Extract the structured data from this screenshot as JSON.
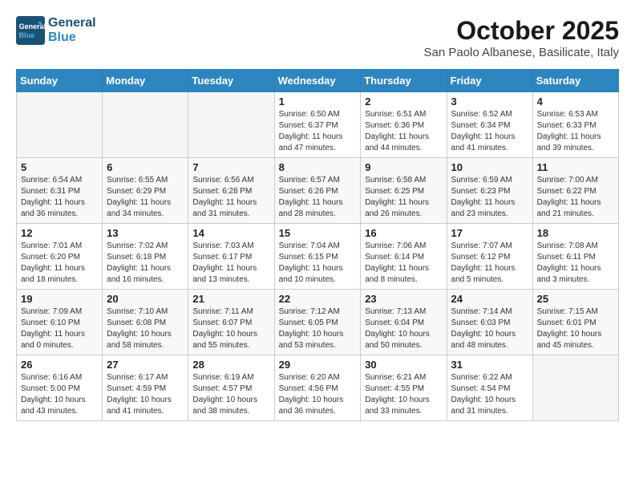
{
  "header": {
    "logo_line1": "General",
    "logo_line2": "Blue",
    "month_title": "October 2025",
    "location": "San Paolo Albanese, Basilicate, Italy"
  },
  "days_of_week": [
    "Sunday",
    "Monday",
    "Tuesday",
    "Wednesday",
    "Thursday",
    "Friday",
    "Saturday"
  ],
  "weeks": [
    [
      {
        "day": "",
        "info": ""
      },
      {
        "day": "",
        "info": ""
      },
      {
        "day": "",
        "info": ""
      },
      {
        "day": "1",
        "info": "Sunrise: 6:50 AM\nSunset: 6:37 PM\nDaylight: 11 hours\nand 47 minutes."
      },
      {
        "day": "2",
        "info": "Sunrise: 6:51 AM\nSunset: 6:36 PM\nDaylight: 11 hours\nand 44 minutes."
      },
      {
        "day": "3",
        "info": "Sunrise: 6:52 AM\nSunset: 6:34 PM\nDaylight: 11 hours\nand 41 minutes."
      },
      {
        "day": "4",
        "info": "Sunrise: 6:53 AM\nSunset: 6:33 PM\nDaylight: 11 hours\nand 39 minutes."
      }
    ],
    [
      {
        "day": "5",
        "info": "Sunrise: 6:54 AM\nSunset: 6:31 PM\nDaylight: 11 hours\nand 36 minutes."
      },
      {
        "day": "6",
        "info": "Sunrise: 6:55 AM\nSunset: 6:29 PM\nDaylight: 11 hours\nand 34 minutes."
      },
      {
        "day": "7",
        "info": "Sunrise: 6:56 AM\nSunset: 6:28 PM\nDaylight: 11 hours\nand 31 minutes."
      },
      {
        "day": "8",
        "info": "Sunrise: 6:57 AM\nSunset: 6:26 PM\nDaylight: 11 hours\nand 28 minutes."
      },
      {
        "day": "9",
        "info": "Sunrise: 6:58 AM\nSunset: 6:25 PM\nDaylight: 11 hours\nand 26 minutes."
      },
      {
        "day": "10",
        "info": "Sunrise: 6:59 AM\nSunset: 6:23 PM\nDaylight: 11 hours\nand 23 minutes."
      },
      {
        "day": "11",
        "info": "Sunrise: 7:00 AM\nSunset: 6:22 PM\nDaylight: 11 hours\nand 21 minutes."
      }
    ],
    [
      {
        "day": "12",
        "info": "Sunrise: 7:01 AM\nSunset: 6:20 PM\nDaylight: 11 hours\nand 18 minutes."
      },
      {
        "day": "13",
        "info": "Sunrise: 7:02 AM\nSunset: 6:18 PM\nDaylight: 11 hours\nand 16 minutes."
      },
      {
        "day": "14",
        "info": "Sunrise: 7:03 AM\nSunset: 6:17 PM\nDaylight: 11 hours\nand 13 minutes."
      },
      {
        "day": "15",
        "info": "Sunrise: 7:04 AM\nSunset: 6:15 PM\nDaylight: 11 hours\nand 10 minutes."
      },
      {
        "day": "16",
        "info": "Sunrise: 7:06 AM\nSunset: 6:14 PM\nDaylight: 11 hours\nand 8 minutes."
      },
      {
        "day": "17",
        "info": "Sunrise: 7:07 AM\nSunset: 6:12 PM\nDaylight: 11 hours\nand 5 minutes."
      },
      {
        "day": "18",
        "info": "Sunrise: 7:08 AM\nSunset: 6:11 PM\nDaylight: 11 hours\nand 3 minutes."
      }
    ],
    [
      {
        "day": "19",
        "info": "Sunrise: 7:09 AM\nSunset: 6:10 PM\nDaylight: 11 hours\nand 0 minutes."
      },
      {
        "day": "20",
        "info": "Sunrise: 7:10 AM\nSunset: 6:08 PM\nDaylight: 10 hours\nand 58 minutes."
      },
      {
        "day": "21",
        "info": "Sunrise: 7:11 AM\nSunset: 6:07 PM\nDaylight: 10 hours\nand 55 minutes."
      },
      {
        "day": "22",
        "info": "Sunrise: 7:12 AM\nSunset: 6:05 PM\nDaylight: 10 hours\nand 53 minutes."
      },
      {
        "day": "23",
        "info": "Sunrise: 7:13 AM\nSunset: 6:04 PM\nDaylight: 10 hours\nand 50 minutes."
      },
      {
        "day": "24",
        "info": "Sunrise: 7:14 AM\nSunset: 6:03 PM\nDaylight: 10 hours\nand 48 minutes."
      },
      {
        "day": "25",
        "info": "Sunrise: 7:15 AM\nSunset: 6:01 PM\nDaylight: 10 hours\nand 45 minutes."
      }
    ],
    [
      {
        "day": "26",
        "info": "Sunrise: 6:16 AM\nSunset: 5:00 PM\nDaylight: 10 hours\nand 43 minutes."
      },
      {
        "day": "27",
        "info": "Sunrise: 6:17 AM\nSunset: 4:59 PM\nDaylight: 10 hours\nand 41 minutes."
      },
      {
        "day": "28",
        "info": "Sunrise: 6:19 AM\nSunset: 4:57 PM\nDaylight: 10 hours\nand 38 minutes."
      },
      {
        "day": "29",
        "info": "Sunrise: 6:20 AM\nSunset: 4:56 PM\nDaylight: 10 hours\nand 36 minutes."
      },
      {
        "day": "30",
        "info": "Sunrise: 6:21 AM\nSunset: 4:55 PM\nDaylight: 10 hours\nand 33 minutes."
      },
      {
        "day": "31",
        "info": "Sunrise: 6:22 AM\nSunset: 4:54 PM\nDaylight: 10 hours\nand 31 minutes."
      },
      {
        "day": "",
        "info": ""
      }
    ]
  ]
}
